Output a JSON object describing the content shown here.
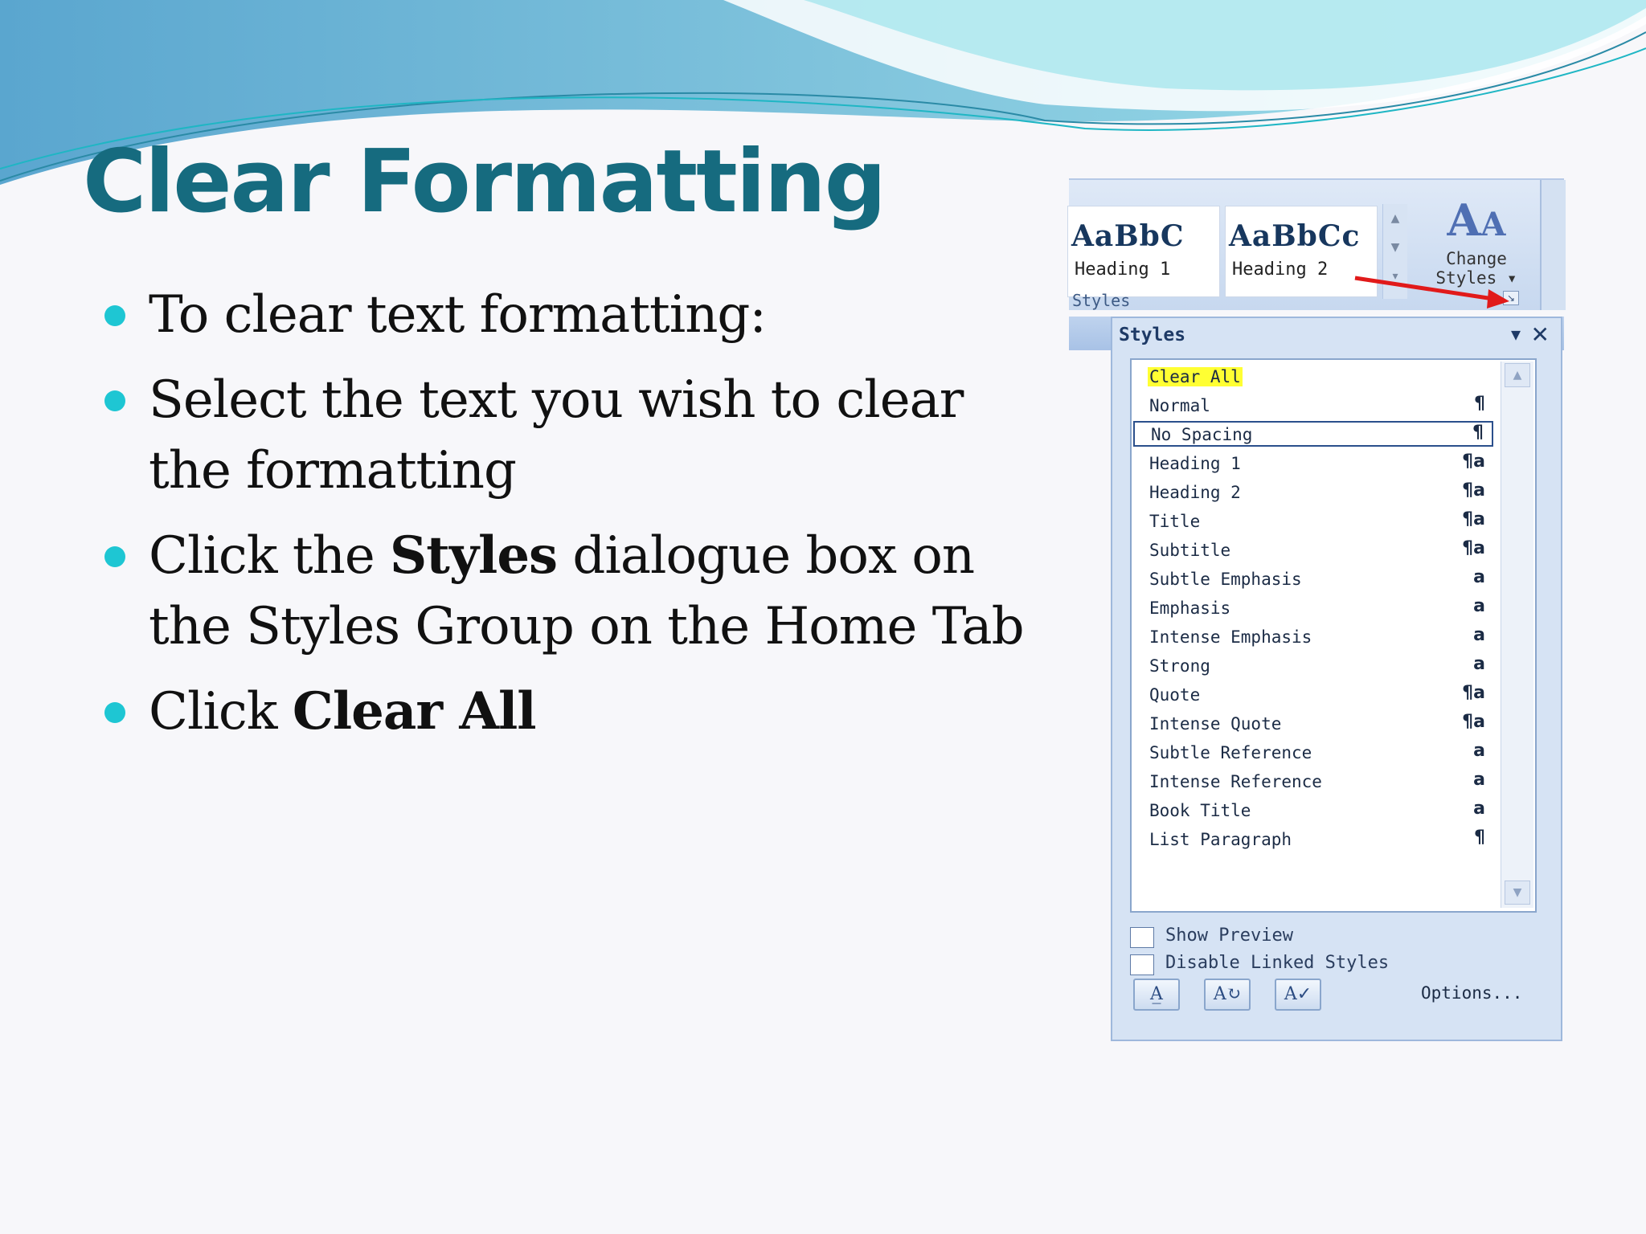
{
  "slide": {
    "title": "Clear Formatting",
    "bullets": [
      {
        "pre": "To clear text formatting:",
        "bold": "",
        "post": ""
      },
      {
        "pre": "Select the text you wish to clear the formatting",
        "bold": "",
        "post": ""
      },
      {
        "pre": "Click the ",
        "bold": "Styles",
        "post": " dialogue box on the Styles Group on the Home Tab"
      },
      {
        "pre": "Click ",
        "bold": "Clear All",
        "post": ""
      }
    ]
  },
  "ribbon": {
    "gallery": [
      {
        "sample": "AaBbC",
        "name": "Heading 1"
      },
      {
        "sample": "AaBbCc",
        "name": "Heading 2"
      }
    ],
    "change_styles_line1": "Change",
    "change_styles_line2": "Styles ▾",
    "group_label": "Styles"
  },
  "styles_pane": {
    "title": "Styles",
    "items": [
      {
        "label": "Clear All",
        "mark": ""
      },
      {
        "label": "Normal",
        "mark": "¶"
      },
      {
        "label": "No Spacing",
        "mark": "¶"
      },
      {
        "label": "Heading 1",
        "mark": "¶a"
      },
      {
        "label": "Heading 2",
        "mark": "¶a"
      },
      {
        "label": "Title",
        "mark": "¶a"
      },
      {
        "label": "Subtitle",
        "mark": "¶a"
      },
      {
        "label": "Subtle Emphasis",
        "mark": "a"
      },
      {
        "label": "Emphasis",
        "mark": "a"
      },
      {
        "label": "Intense Emphasis",
        "mark": "a"
      },
      {
        "label": "Strong",
        "mark": "a"
      },
      {
        "label": "Quote",
        "mark": "¶a"
      },
      {
        "label": "Intense Quote",
        "mark": "¶a"
      },
      {
        "label": "Subtle Reference",
        "mark": "a"
      },
      {
        "label": "Intense Reference",
        "mark": "a"
      },
      {
        "label": "Book Title",
        "mark": "a"
      },
      {
        "label": "List Paragraph",
        "mark": "¶"
      }
    ],
    "highlighted_item": "Clear All",
    "selected_item": "No Spacing",
    "show_preview": "Show Preview",
    "disable_linked": "Disable Linked Styles",
    "options": "Options..."
  },
  "icons": [
    "dropdown-arrow-icon",
    "close-icon",
    "scroll-up-icon",
    "scroll-down-icon",
    "new-style-icon",
    "style-inspector-icon",
    "manage-styles-icon",
    "dialog-launcher-icon",
    "change-styles-icon"
  ],
  "colors": {
    "title": "#166b7f",
    "bullet": "#1ec6d3",
    "arrow": "#e11a1a",
    "highlight": "#ffff33"
  }
}
